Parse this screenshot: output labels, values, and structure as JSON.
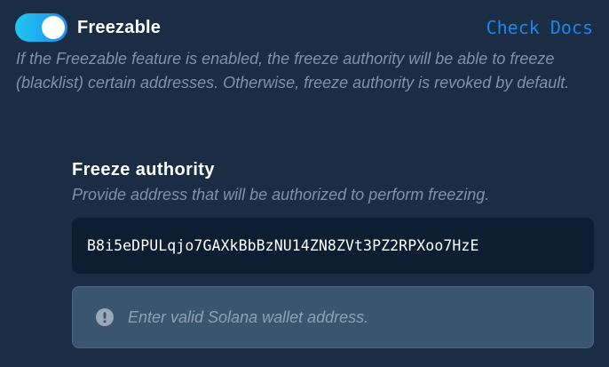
{
  "feature": {
    "title": "Freezable",
    "enabled": true,
    "docs_link": "Check Docs",
    "description": "If the Freezable feature is enabled, the freeze authority will be able to freeze (blacklist) certain addresses. Otherwise, freeze authority is revoked by default."
  },
  "freeze_authority": {
    "label": "Freeze authority",
    "hint": "Provide address that will be authorized to perform freezing.",
    "value": "B8i5eDPULqjo7GAXkBbBzNU14ZN8ZVt3PZ2RPXoo7HzE",
    "error_icon": "exclamation-circle-icon",
    "error_message": "Enter valid Solana wallet address."
  },
  "colors": {
    "background": "#1a2d45",
    "toggle_gradient_start": "#1fc7f0",
    "toggle_gradient_end": "#1f8bf0",
    "link": "#1d86e8",
    "input_background": "#0d1d32",
    "error_background": "#3c556f"
  }
}
